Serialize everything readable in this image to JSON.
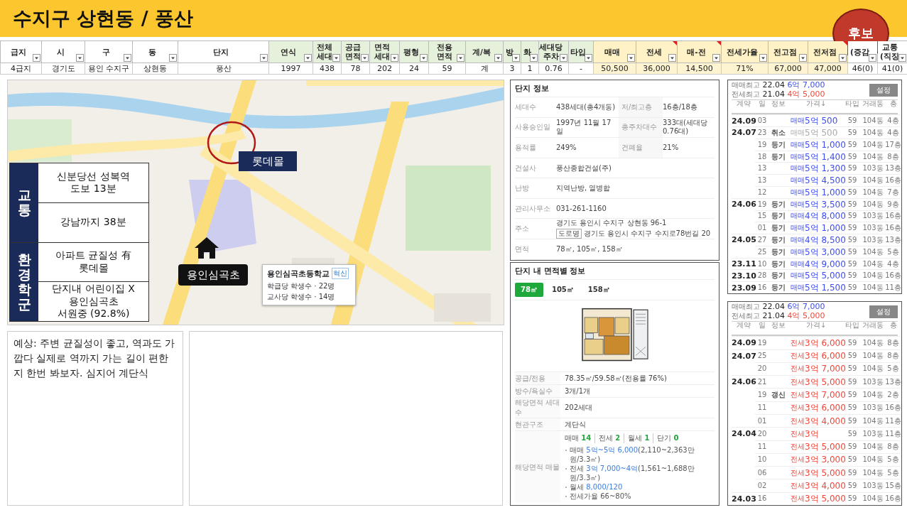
{
  "title": "수지구 상현동 / 풍산",
  "badge": "후보",
  "sheet": {
    "columns": [
      {
        "lines": [
          "급지"
        ],
        "kind": "basic",
        "note": false
      },
      {
        "lines": [
          "시"
        ],
        "kind": "basic",
        "note": false
      },
      {
        "lines": [
          "구"
        ],
        "kind": "basic",
        "note": false
      },
      {
        "lines": [
          "동"
        ],
        "kind": "basic",
        "note": false
      },
      {
        "lines": [
          "단지"
        ],
        "kind": "basic",
        "note": false
      },
      {
        "lines": [
          "연식"
        ],
        "kind": "spec",
        "note": false
      },
      {
        "lines": [
          "전체",
          "세대"
        ],
        "kind": "spec",
        "note": false
      },
      {
        "lines": [
          "공급",
          "면적"
        ],
        "kind": "spec",
        "note": false
      },
      {
        "lines": [
          "면적",
          "세대"
        ],
        "kind": "spec",
        "note": false
      },
      {
        "lines": [
          "평형"
        ],
        "kind": "spec",
        "note": false
      },
      {
        "lines": [
          "전용",
          "면적"
        ],
        "kind": "spec",
        "note": false
      },
      {
        "lines": [
          "계/복"
        ],
        "kind": "spec",
        "note": false
      },
      {
        "lines": [
          "방"
        ],
        "kind": "spec",
        "note": false
      },
      {
        "lines": [
          "화"
        ],
        "kind": "spec",
        "note": false
      },
      {
        "lines": [
          "세대당",
          "주차"
        ],
        "kind": "spec",
        "note": false
      },
      {
        "lines": [
          "타입"
        ],
        "kind": "spec",
        "note": false
      },
      {
        "lines": [
          "매매"
        ],
        "kind": "price",
        "note": false
      },
      {
        "lines": [
          "전세"
        ],
        "kind": "price",
        "note": true
      },
      {
        "lines": [
          "매-전"
        ],
        "kind": "price",
        "note": true
      },
      {
        "lines": [
          "전세가율"
        ],
        "kind": "price",
        "note": false
      },
      {
        "lines": [
          "전고점"
        ],
        "kind": "price",
        "note": false
      },
      {
        "lines": [
          "전저점"
        ],
        "kind": "price",
        "note": true
      },
      {
        "lines": [
          "(증감"
        ],
        "kind": "basic",
        "note": false
      },
      {
        "lines": [
          "교통",
          "(직징"
        ],
        "kind": "basic",
        "note": false
      }
    ],
    "row": [
      "4급지",
      "경기도",
      "용인 수지구",
      "상현동",
      "풍산",
      "1997",
      "438",
      "78",
      "202",
      "24",
      "59",
      "계",
      "3",
      "1",
      "0.76",
      "-",
      "50,500",
      "36,000",
      "14,500",
      "71%",
      "67,000",
      "47,000",
      "46(0)",
      "41(0)"
    ]
  },
  "map": {
    "kind": "picture",
    "sections": [
      {
        "heading": "교통",
        "rows": [
          [
            "신분당선 성복역",
            "도보 13분"
          ],
          [
            "강남까지 38분"
          ]
        ]
      },
      {
        "heading": "환경학군",
        "rows": [
          [
            "아파트 균질성 有",
            "롯데몰"
          ],
          [
            "단지내 어린이집 X",
            "용인심곡초",
            "서원중 (92.8%)"
          ]
        ]
      }
    ],
    "mall_label": "롯데몰",
    "school_label": "용인심곡초",
    "school_popup": {
      "name": "용인심곡초등학교",
      "tag": "혁신",
      "lines": [
        "학급당 학생수 · 22명",
        "교사당 학생수 · 14명"
      ]
    }
  },
  "memo": "예상: 주변 균질성이 좋고, 역과도 가깝다 실제로 역까지 가는 길이 편한지 한번 봐보자. 심지어 계단식",
  "info": {
    "title": "단지 정보",
    "rows": [
      {
        "kind": "pair",
        "label": "세대수",
        "value": "438세대(총4개동)",
        "label2": "저/최고층",
        "value2": "16층/18층"
      },
      {
        "kind": "pair",
        "label": "사용승인일",
        "value": "1997년 11월 17일",
        "label2": "총주차대수",
        "value2": "333대(세대당 0.76대)"
      },
      {
        "kind": "pair",
        "label": "용적률",
        "value": "249%",
        "label2": "건폐율",
        "value2": "21%"
      },
      {
        "kind": "single",
        "label": "건설사",
        "value": "풍산종합건설(주)"
      },
      {
        "kind": "single",
        "label": "난방",
        "value": "지역난방, 열병합"
      },
      {
        "kind": "single",
        "label": "관리사무소",
        "value": "031-261-1160"
      },
      {
        "kind": "address",
        "label": "주소",
        "value": "경기도 용인시 수지구 상현동 96-1",
        "tag": "도로명",
        "value2": "경기도 용인시 수지구 수지로78번길 20"
      },
      {
        "kind": "single",
        "label": "면적",
        "value": "78㎡, 105㎡, 158㎡"
      }
    ]
  },
  "area": {
    "title": "단지 내 면적별 정보",
    "tabs": [
      {
        "label": "78㎡",
        "selected": true
      },
      {
        "label": "105㎡",
        "selected": false
      },
      {
        "label": "158㎡",
        "selected": false
      }
    ],
    "specs": [
      {
        "label": "공급/전용",
        "value": "78.35㎡/59.58㎡(전용률 76%)"
      },
      {
        "label": "방수/욕실수",
        "value": "3개/1개"
      },
      {
        "label": "해당면적 세대수",
        "value": "202세대"
      },
      {
        "label": "현관구조",
        "value": "계단식"
      }
    ],
    "listings": {
      "label": "해당면적 매물",
      "counts": [
        {
          "name": "매매",
          "count": "14"
        },
        {
          "name": "전세",
          "count": "2"
        },
        {
          "name": "월세",
          "count": "1"
        },
        {
          "name": "단기",
          "count": "0"
        }
      ],
      "items": [
        {
          "name": "매매",
          "value": "5억~5억 6,000",
          "note": "(2,110~2,363만원/3.3㎡)",
          "highlight": true
        },
        {
          "name": "전세",
          "value": "3억 7,000~4억",
          "note": "(1,561~1,688만원/3.3㎡)",
          "highlight": true
        },
        {
          "name": "월세",
          "value": "8,000/120",
          "highlight": true
        },
        {
          "name": "전세가율",
          "value": "66~80%",
          "highlight": false
        }
      ]
    }
  },
  "trades": [
    {
      "highs": [
        {
          "label": "매매최고",
          "date": "22.04",
          "price": "6억 7,000",
          "kind": "sale"
        },
        {
          "label": "전세최고",
          "date": "21.04",
          "price": "4억 5,000",
          "kind": "jeonse"
        }
      ],
      "button": "설정",
      "columns": [
        "계약",
        "일",
        "정보",
        "가격↓",
        "타입",
        "거래동",
        "층"
      ],
      "rows": [
        {
          "month": "24.09",
          "day": "03",
          "deal": "매매",
          "price": "5억 500",
          "kind": "sale",
          "type": "59",
          "building": "104동",
          "floor": "4층",
          "cancelled": false
        },
        {
          "month": "24.07",
          "day": "23",
          "info": "취소",
          "deal": "매매",
          "price": "5억 500",
          "kind": "sale",
          "type": "59",
          "building": "104동",
          "floor": "4층",
          "cancelled": true
        },
        {
          "day": "19",
          "info": "등기",
          "deal": "매매",
          "price": "5억 1,000",
          "kind": "sale",
          "type": "59",
          "building": "104동",
          "floor": "17층",
          "cancelled": false
        },
        {
          "day": "18",
          "info": "등기",
          "deal": "매매",
          "price": "5억 1,400",
          "kind": "sale",
          "type": "59",
          "building": "104동",
          "floor": "8층",
          "cancelled": false
        },
        {
          "day": "13",
          "deal": "매매",
          "price": "5억 1,300",
          "kind": "sale",
          "type": "59",
          "building": "103동",
          "floor": "13층",
          "cancelled": false
        },
        {
          "day": "13",
          "deal": "매매",
          "price": "5억 4,500",
          "kind": "sale",
          "type": "59",
          "building": "104동",
          "floor": "16층",
          "cancelled": false
        },
        {
          "day": "12",
          "deal": "매매",
          "price": "5억 1,000",
          "kind": "sale",
          "type": "59",
          "building": "104동",
          "floor": "7층",
          "cancelled": false
        },
        {
          "month": "24.06",
          "day": "19",
          "info": "등기",
          "deal": "매매",
          "price": "5억 3,500",
          "kind": "sale",
          "type": "59",
          "building": "104동",
          "floor": "9층",
          "cancelled": false
        },
        {
          "day": "15",
          "info": "등기",
          "deal": "매매",
          "price": "4억 8,000",
          "kind": "sale",
          "type": "59",
          "building": "103동",
          "floor": "16층",
          "cancelled": false
        },
        {
          "day": "01",
          "info": "등기",
          "deal": "매매",
          "price": "5억 1,000",
          "kind": "sale",
          "type": "59",
          "building": "103동",
          "floor": "16층",
          "cancelled": false
        },
        {
          "month": "24.05",
          "day": "27",
          "info": "등기",
          "deal": "매매",
          "price": "4억 8,500",
          "kind": "sale",
          "type": "59",
          "building": "103동",
          "floor": "13층",
          "cancelled": false
        },
        {
          "day": "25",
          "info": "등기",
          "deal": "매매",
          "price": "5억 3,000",
          "kind": "sale",
          "type": "59",
          "building": "104동",
          "floor": "5층",
          "cancelled": false
        },
        {
          "month": "23.11",
          "day": "10",
          "info": "등기",
          "deal": "매매",
          "price": "4억 9,000",
          "kind": "sale",
          "type": "59",
          "building": "104동",
          "floor": "4층",
          "cancelled": false
        },
        {
          "month": "23.10",
          "day": "28",
          "info": "등기",
          "deal": "매매",
          "price": "5억 5,000",
          "kind": "sale",
          "type": "59",
          "building": "104동",
          "floor": "16층",
          "cancelled": false
        },
        {
          "month": "23.09",
          "day": "16",
          "info": "등기",
          "deal": "매매",
          "price": "5억 1,500",
          "kind": "sale",
          "type": "59",
          "building": "104동",
          "floor": "11층",
          "cancelled": false
        }
      ]
    },
    {
      "highs": [
        {
          "label": "매매최고",
          "date": "22.04",
          "price": "6억 7,000",
          "kind": "sale"
        },
        {
          "label": "전세최고",
          "date": "21.04",
          "price": "4억 5,000",
          "kind": "jeonse"
        }
      ],
      "button": "설정",
      "columns": [
        "계약",
        "일",
        "정보",
        "가격↓",
        "타입",
        "거래동",
        "층"
      ],
      "rows": [
        {
          "month": "24.09",
          "day": "19",
          "deal": "전세",
          "price": "3억 6,000",
          "kind": "jeonse",
          "type": "59",
          "building": "104동",
          "floor": "8층",
          "cancelled": false
        },
        {
          "month": "24.07",
          "day": "25",
          "deal": "전세",
          "price": "3억 6,000",
          "kind": "jeonse",
          "type": "59",
          "building": "104동",
          "floor": "8층",
          "cancelled": false
        },
        {
          "day": "20",
          "deal": "전세",
          "price": "3억 7,000",
          "kind": "jeonse",
          "type": "59",
          "building": "104동",
          "floor": "5층",
          "cancelled": false
        },
        {
          "month": "24.06",
          "day": "21",
          "deal": "전세",
          "price": "3억 5,000",
          "kind": "jeonse",
          "type": "59",
          "building": "103동",
          "floor": "13층",
          "cancelled": false
        },
        {
          "day": "19",
          "info": "갱신",
          "deal": "전세",
          "price": "3억 7,000",
          "kind": "jeonse",
          "type": "59",
          "building": "104동",
          "floor": "2층",
          "cancelled": false
        },
        {
          "day": "11",
          "deal": "전세",
          "price": "3억 6,000",
          "kind": "jeonse",
          "type": "59",
          "building": "103동",
          "floor": "16층",
          "cancelled": false
        },
        {
          "day": "01",
          "deal": "전세",
          "price": "3억 4,000",
          "kind": "jeonse",
          "type": "59",
          "building": "104동",
          "floor": "11층",
          "cancelled": false
        },
        {
          "month": "24.04",
          "day": "20",
          "deal": "전세",
          "price": "3억",
          "kind": "jeonse",
          "type": "59",
          "building": "103동",
          "floor": "11층",
          "cancelled": false
        },
        {
          "day": "11",
          "deal": "전세",
          "price": "3억 5,000",
          "kind": "jeonse",
          "type": "59",
          "building": "104동",
          "floor": "8층",
          "cancelled": false
        },
        {
          "day": "10",
          "deal": "전세",
          "price": "3억 3,000",
          "kind": "jeonse",
          "type": "59",
          "building": "104동",
          "floor": "5층",
          "cancelled": false
        },
        {
          "day": "06",
          "deal": "전세",
          "price": "3억 5,000",
          "kind": "jeonse",
          "type": "59",
          "building": "104동",
          "floor": "5층",
          "cancelled": false
        },
        {
          "day": "02",
          "deal": "전세",
          "price": "3억 4,000",
          "kind": "jeonse",
          "type": "59",
          "building": "103동",
          "floor": "15층",
          "cancelled": false
        },
        {
          "month": "24.03",
          "day": "16",
          "deal": "전세",
          "price": "3억 5,000",
          "kind": "jeonse",
          "type": "59",
          "building": "104동",
          "floor": "16층",
          "cancelled": false
        }
      ]
    }
  ]
}
